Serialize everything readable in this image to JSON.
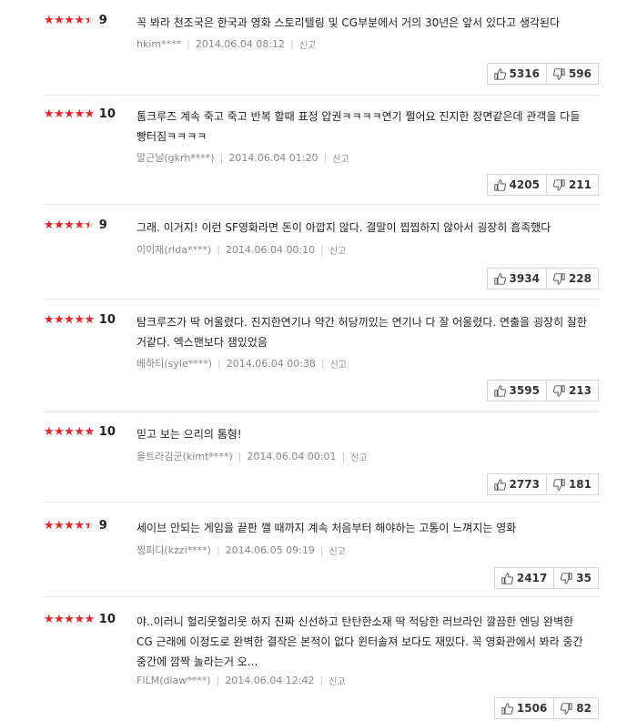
{
  "icons": {
    "star": "star-icon",
    "up": "thumbs-up-icon",
    "down": "thumbs-down-icon",
    "accent": "#e8242c"
  },
  "reviews": [
    {
      "score": "9",
      "stars": 0.9,
      "text": "꼭 봐라 천조국은 한국과 영화 스토리텔링 및 CG부분에서 거의 30년은 앞서 있다고 생각된다",
      "user": "hkim****",
      "date": "2014.06.04 08:12",
      "report": "신고",
      "up": "5316",
      "down": "596"
    },
    {
      "score": "10",
      "stars": 1.0,
      "text": "톰크루즈 계속 죽고 죽고 반복 할때 표정 압권ㅋㅋㅋㅋ연기 쩔어요 진지한 장면같은데 관객을 다들 빵터짐ㅋㅋㅋㅋ",
      "user": "말근날(gkrh****)",
      "date": "2014.06.04 01:20",
      "report": "신고",
      "up": "4205",
      "down": "211"
    },
    {
      "score": "9",
      "stars": 0.9,
      "text": "그래. 이거지! 이런 SF영화라면 돈이 아깝지 않다. 결말이 찝찝하지 않아서 굉장히 흡족했다",
      "user": "이이재(rlda****)",
      "date": "2014.06.04 00:10",
      "report": "신고",
      "up": "3934",
      "down": "228"
    },
    {
      "score": "10",
      "stars": 1.0,
      "text": "탐크루즈가 딱 어울렸다. 진지한연기나 약간 허당끼있는 연기나 다 잘 어울렸다. 연출을 굉장히 잘한거같다. 엑스맨보다 잼있었음",
      "user": "베하티(syle****)",
      "date": "2014.06.04 00:38",
      "report": "신고",
      "up": "3595",
      "down": "213"
    },
    {
      "score": "10",
      "stars": 1.0,
      "text": "믿고 보는 으리의 톰형!",
      "user": "울트라김군(kimt****)",
      "date": "2014.06.04 00:01",
      "report": "신고",
      "up": "2773",
      "down": "181"
    },
    {
      "score": "9",
      "stars": 0.9,
      "text": "세이브 안되는 게임을 끝판 깰 때까지 계속 처음부터 해야하는 고통이 느껴지는 영화",
      "user": "찡피디(kzzi****)",
      "date": "2014.06.05 09:19",
      "report": "신고",
      "up": "2417",
      "down": "35"
    },
    {
      "score": "10",
      "stars": 1.0,
      "text": "야..이러니 헐리웃헐리웃 하지 진짜 신선하고 탄탄한소재 딱 적당한 러브라인 깔끔한 엔딩 완벽한 CG 근래에 이정도로 완벽한 결작은 본적이 없다 윈터솔져 보다도 재밌다. 꼭 영화관에서 봐라 중간중간에 깜짝 놀라는거 오...",
      "user": "FILM(dlaw****)",
      "date": "2014.06.04 12:42",
      "report": "신고",
      "up": "1506",
      "down": "82"
    }
  ]
}
